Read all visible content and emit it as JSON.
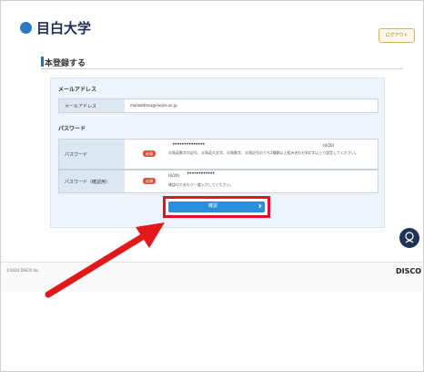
{
  "header": {
    "logo": "目白大学",
    "login_button": "ログアウト"
  },
  "page": {
    "heading": "本登録する"
  },
  "email_section": {
    "label": "メールアドレス",
    "field_label": "メールアドレス",
    "value": "mailaddress@mejiro.ac.jp"
  },
  "password_section": {
    "label": "パスワード",
    "password": {
      "label": "パスワード",
      "required": "必須",
      "value": "••••••••••••••",
      "counter": "(0/20)",
      "hint": "半角英数字の記号、半角英大文字、半角数字、半角記号のうち2種類以上組み合わせ8文字以上で設定してください。"
    },
    "confirm": {
      "label": "パスワード（確認用）",
      "required": "必須",
      "counter": "(0/20)",
      "value": "••••••••••••",
      "hint": "確認のためもう一度入力してください。"
    }
  },
  "confirm_button": {
    "label": "確認"
  },
  "footer": {
    "copyright": "©2024 DISCO Inc.",
    "brand": "DISCO"
  },
  "colors": {
    "accent": "#2a8fd6",
    "highlight": "#e3122a",
    "required": "#e14a3a"
  }
}
